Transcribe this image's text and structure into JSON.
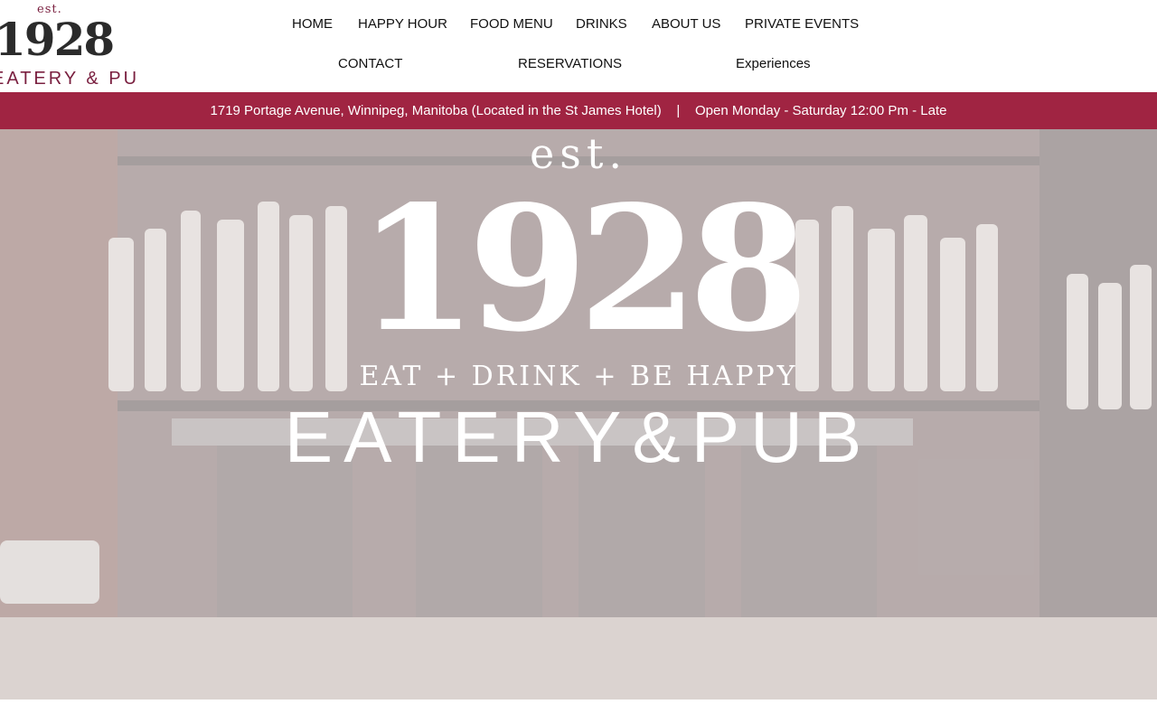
{
  "logo": {
    "est": "est.",
    "year": "1928",
    "subtitle": "EATERY & PUB"
  },
  "nav": {
    "items": [
      "HOME",
      "HAPPY HOUR",
      "FOOD MENU",
      "DRINKS",
      "ABOUT US",
      "PRIVATE EVENTS",
      "CONTACT",
      "RESERVATIONS",
      "Experiences"
    ]
  },
  "infobar": {
    "address": "1719 Portage Avenue, Winnipeg, Manitoba (Located in the St James Hotel)",
    "separator": "|",
    "hours": "Open Monday - Saturday 12:00 Pm - Late"
  },
  "hero": {
    "est": "est.",
    "year": "1928",
    "tagline": "EAT + DRINK + BE HAPPY",
    "name": "EATERY&PUB"
  },
  "colors": {
    "accent": "#a02442",
    "logo_accent": "#7a2040"
  }
}
